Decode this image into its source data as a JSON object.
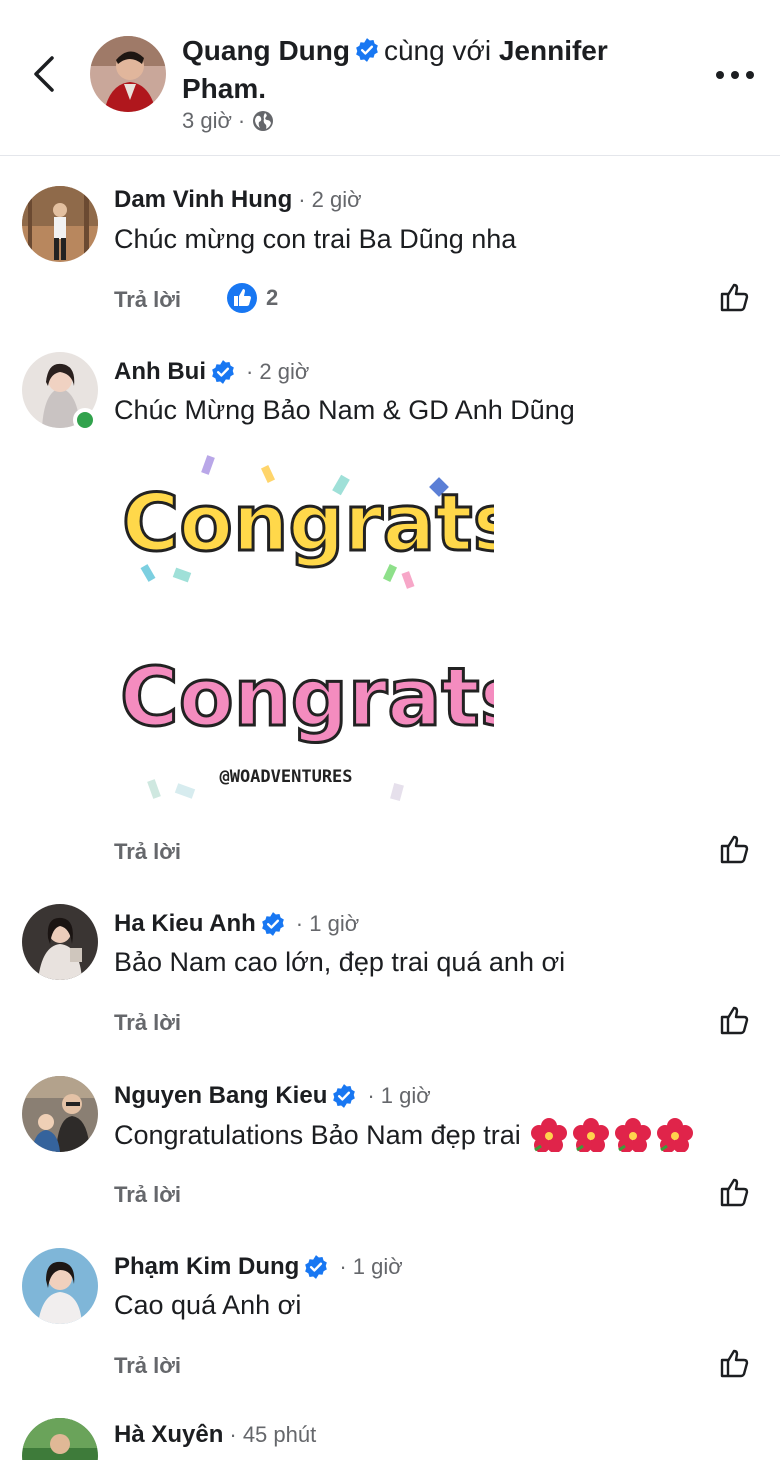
{
  "post": {
    "author": "Quang Dung",
    "with_text": "cùng với",
    "tagged": "Jennifer Pham.",
    "time": "3 giờ",
    "separator": "·"
  },
  "reply_label": "Trả lời",
  "comments": [
    {
      "name": "Dam Vinh Hung",
      "verified": false,
      "time": "· 2 giờ",
      "text": "Chúc mừng con trai Ba Dũng nha",
      "reaction_count": "2"
    },
    {
      "name": "Anh Bui",
      "verified": true,
      "time": "· 2 giờ",
      "text": "Chúc Mừng Bảo Nam & GD Anh Dũng"
    },
    {
      "name": "Ha Kieu Anh",
      "verified": true,
      "time": "· 1 giờ",
      "text": "Bảo Nam cao lớn, đẹp trai quá anh ơi"
    },
    {
      "name": "Nguyen Bang Kieu",
      "verified": true,
      "time": "· 1 giờ",
      "text": "Congratulations Bảo Nam đẹp trai"
    },
    {
      "name": "Phạm Kim Dung",
      "verified": true,
      "time": "· 1 giờ",
      "text": "Cao quá Anh ơi"
    },
    {
      "name": "Hà Xuyên",
      "verified": false,
      "time": "· 45 phút"
    }
  ],
  "sticker": {
    "word_top": "Congrats",
    "word_bottom": "Congrats",
    "credit": "@WOADVENTURES"
  },
  "colors": {
    "accent": "#1877f2",
    "online": "#31a24c",
    "muted": "#65676b"
  },
  "icons": [
    "back-icon",
    "more-icon",
    "globe-icon",
    "verified-icon",
    "like-reaction-icon",
    "thumbs-up-icon",
    "hibiscus-icon"
  ]
}
